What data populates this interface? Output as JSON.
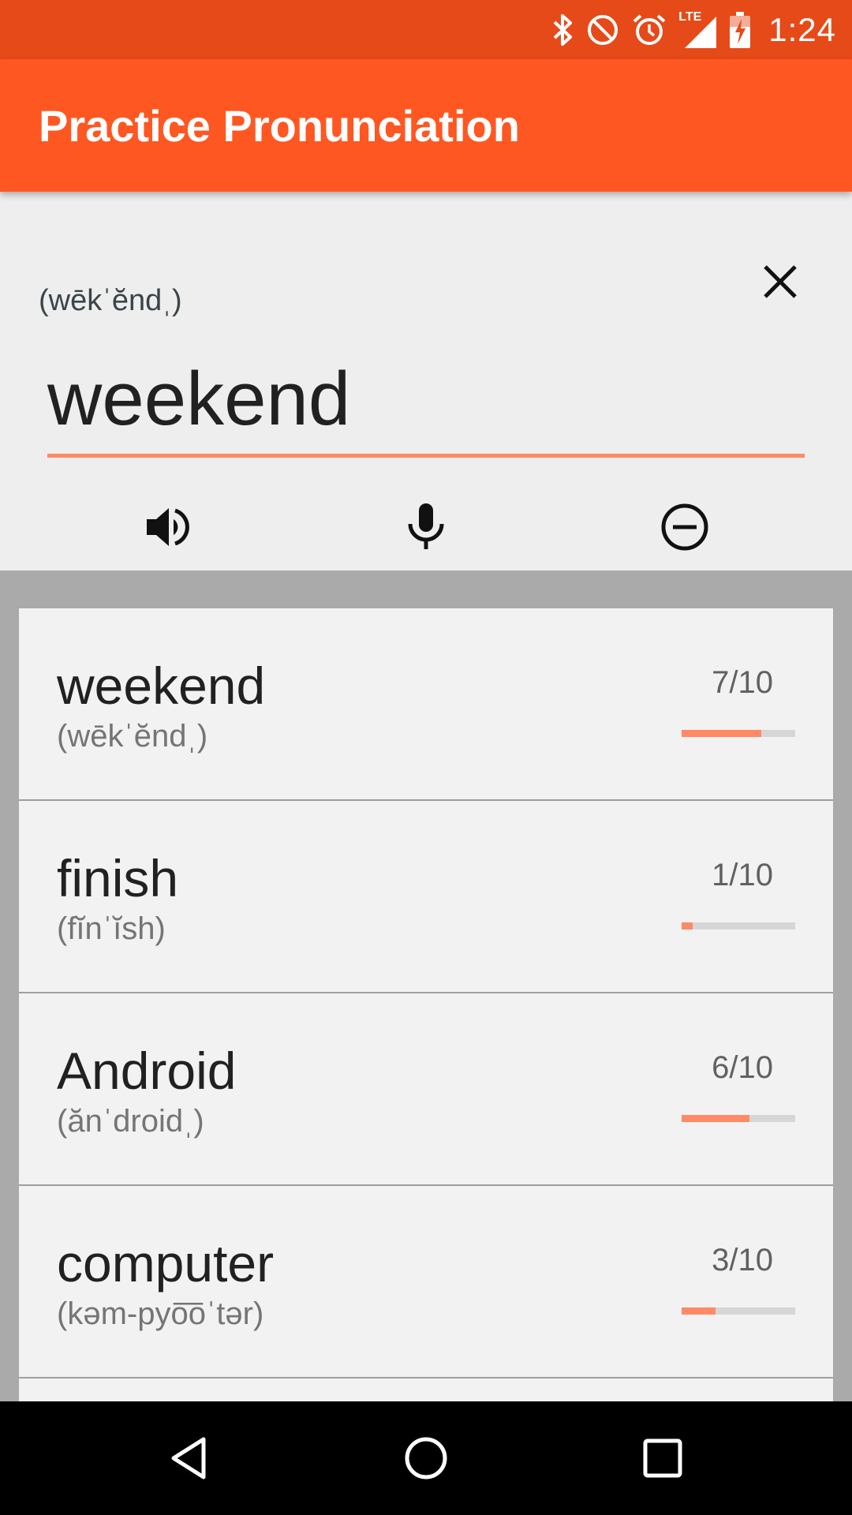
{
  "status_bar": {
    "time": "1:24",
    "network": "LTE",
    "icons": [
      "bluetooth-icon",
      "do-not-disturb-icon",
      "alarm-icon",
      "lte-signal-icon",
      "battery-charging-icon"
    ]
  },
  "app_bar": {
    "title": "Practice Pronunciation"
  },
  "editor": {
    "phonetic": "(wēkˈĕndˌ)",
    "input_value": "weekend",
    "close_icon": "close-icon",
    "actions": [
      "speaker-icon",
      "microphone-icon",
      "remove-icon"
    ]
  },
  "words": [
    {
      "word": "weekend",
      "phonetic": "(wēkˈĕndˌ)",
      "score_label": "7/10",
      "score": 7,
      "max": 10
    },
    {
      "word": "finish",
      "phonetic": "(fĭnˈĭsh)",
      "score_label": "1/10",
      "score": 1,
      "max": 10
    },
    {
      "word": "Android",
      "phonetic": "(ănˈdroidˌ)",
      "score_label": "6/10",
      "score": 6,
      "max": 10
    },
    {
      "word": "computer",
      "phonetic": "(kəm-pyo͞oˈtər)",
      "score_label": "3/10",
      "score": 3,
      "max": 10
    }
  ],
  "nav_bar": {
    "icons": [
      "back-icon",
      "home-icon",
      "recents-icon"
    ]
  },
  "colors": {
    "primary": "#ff5722",
    "primary_dark": "#e64a19",
    "accent": "#ff8a65",
    "list_background": "#aaaaaa",
    "card_background": "#f2f2f2"
  }
}
